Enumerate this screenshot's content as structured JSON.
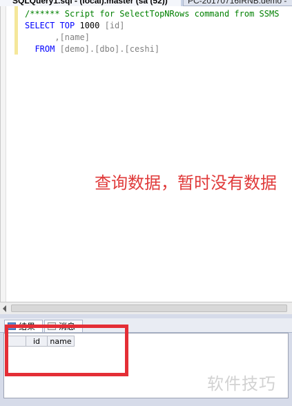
{
  "tabs": {
    "active": "SQLQuery1.sql - (local).master (sa (52))",
    "inactive": "PC-20170716IRNB.demo - "
  },
  "editor": {
    "lines": [
      {
        "parts": [
          {
            "cls": "comment",
            "text": "/****** Script for SelectTopNRows command from SSMS"
          }
        ]
      },
      {
        "parts": [
          {
            "cls": "kw",
            "text": "SELECT TOP "
          },
          {
            "cls": "plain",
            "text": "1000 "
          },
          {
            "cls": "ident",
            "text": "[id]"
          }
        ]
      },
      {
        "parts": [
          {
            "cls": "plain",
            "text": "      "
          },
          {
            "cls": "ident",
            "text": ",[name]"
          }
        ]
      },
      {
        "parts": [
          {
            "cls": "plain",
            "text": "  "
          },
          {
            "cls": "kw",
            "text": "FROM "
          },
          {
            "cls": "ident",
            "text": "[demo].[dbo].[ceshi]"
          }
        ]
      }
    ]
  },
  "annotation": "查询数据，暂时没有数据",
  "results": {
    "tab_results": "结果",
    "tab_messages": "消息",
    "columns": [
      "id",
      "name"
    ]
  },
  "watermark": "软件技巧",
  "colors": {
    "highlight_box": "#e42e36",
    "annotation_text": "#e03a3a"
  }
}
